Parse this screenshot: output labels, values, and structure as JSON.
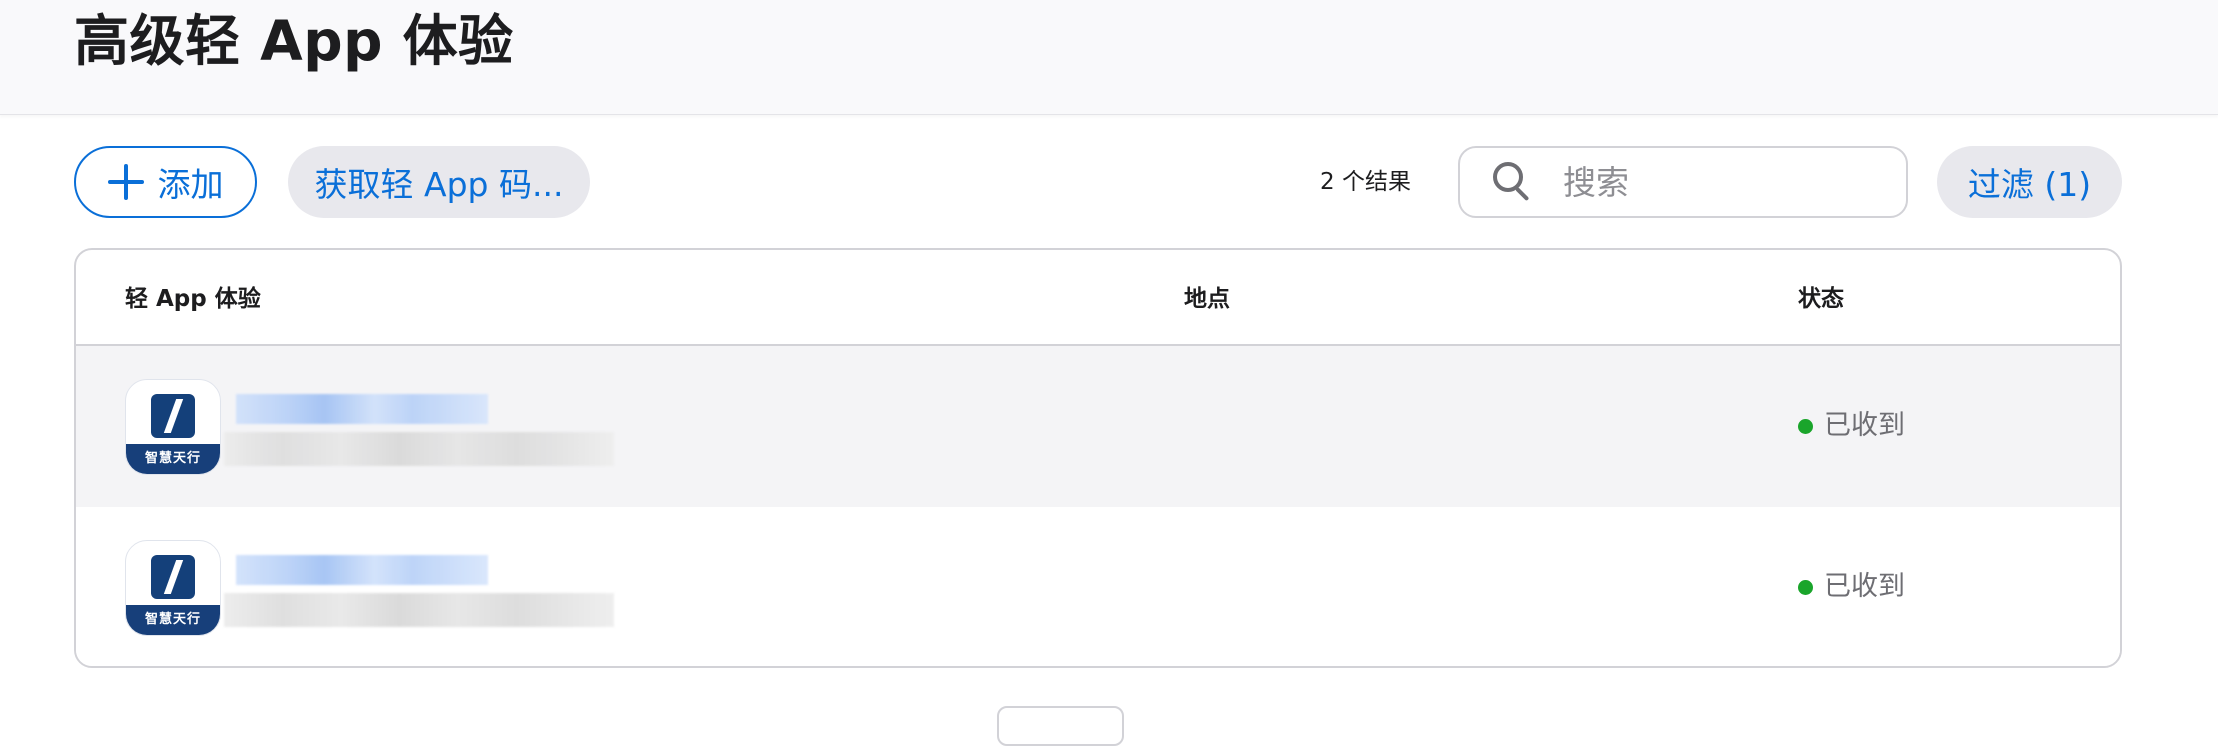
{
  "header": {
    "title": "高级轻 App 体验"
  },
  "toolbar": {
    "add_label": "添加",
    "get_code_label": "获取轻 App 码...",
    "result_count": "2 个结果",
    "search_placeholder": "搜索",
    "filter_label": "过滤 (1)"
  },
  "table": {
    "columns": [
      "轻 App 体验",
      "地点",
      "状态"
    ],
    "rows": [
      {
        "icon_caption": "智慧天行",
        "status": "已收到"
      },
      {
        "icon_caption": "智慧天行",
        "status": "已收到"
      }
    ]
  },
  "colors": {
    "accent": "#0a6fd8",
    "status_received": "#1aa52b",
    "header_bg": "#f9f9fb",
    "row_hover_bg": "#f4f4f6"
  },
  "icons": {
    "add": "plus-icon",
    "search": "search-icon",
    "status": "status-dot-icon"
  }
}
